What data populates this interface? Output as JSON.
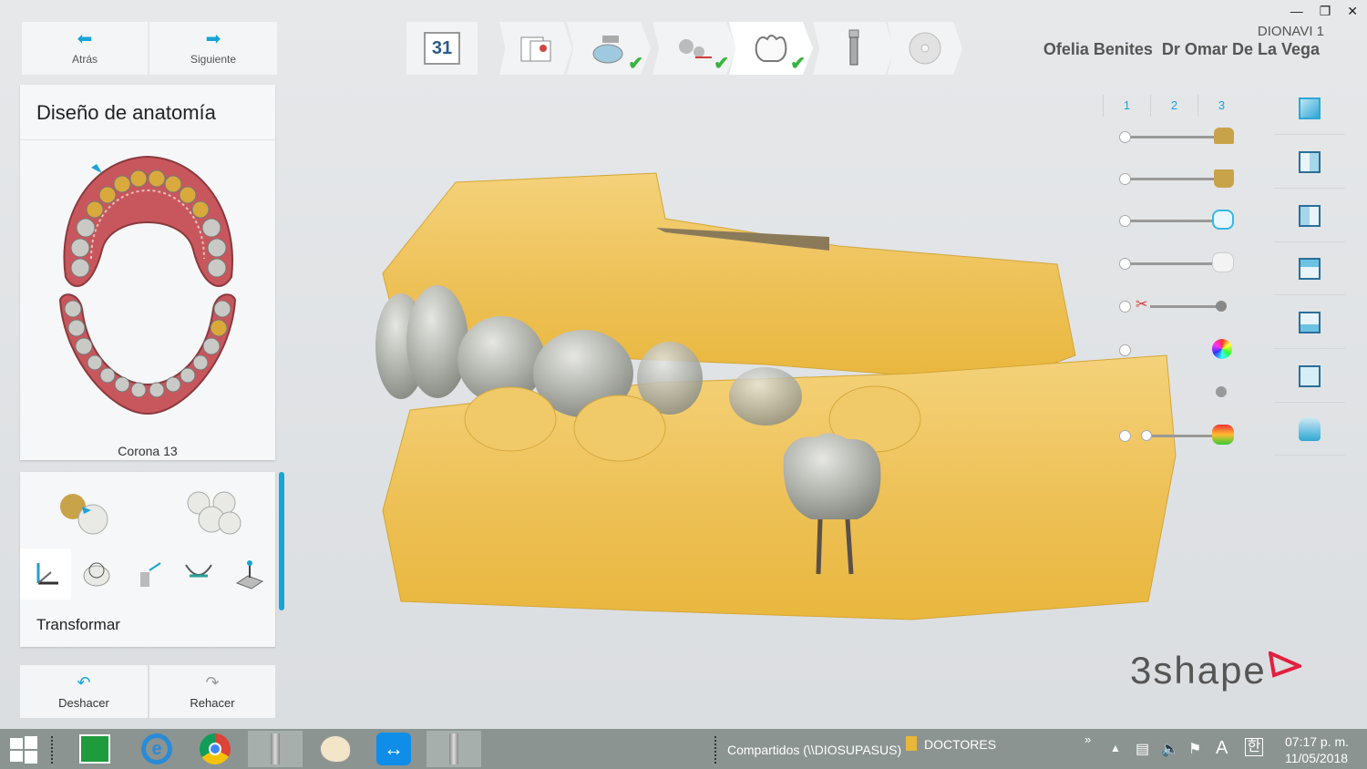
{
  "window": {
    "case_name": "DIONAVI 1",
    "patient_doctor": "Ofelia Benites  Dr Omar De La Vega"
  },
  "nav": {
    "back_label": "Atrás",
    "next_label": "Siguiente"
  },
  "design": {
    "title": "Diseño de anatomía",
    "selected_tooth": "Corona 13"
  },
  "tools": {
    "section_label": "Transformar"
  },
  "history": {
    "undo_label": "Deshacer",
    "redo_label": "Rehacer"
  },
  "workflow_steps": [
    {
      "icon": "calendar-icon",
      "text": "31",
      "done": false
    },
    {
      "icon": "order-form-icon",
      "done": false
    },
    {
      "icon": "scanner-icon",
      "done": true
    },
    {
      "icon": "scissors-icon",
      "done": true
    },
    {
      "icon": "crown-icon",
      "done": true,
      "active": true
    },
    {
      "icon": "implant-icon",
      "done": false
    },
    {
      "icon": "disc-icon",
      "done": false
    }
  ],
  "layers": {
    "tabs": [
      "1",
      "2",
      "3"
    ]
  },
  "brand": {
    "logo_text": "3shape",
    "accent_color": "#e2203f",
    "primary_color": "#1aa3d6"
  },
  "taskbar": {
    "path_label": "Compartidos (\\\\DIOSUPASUS)",
    "folder_label": "DOCTORES",
    "time": "07:17 p. m.",
    "date": "11/05/2018"
  }
}
